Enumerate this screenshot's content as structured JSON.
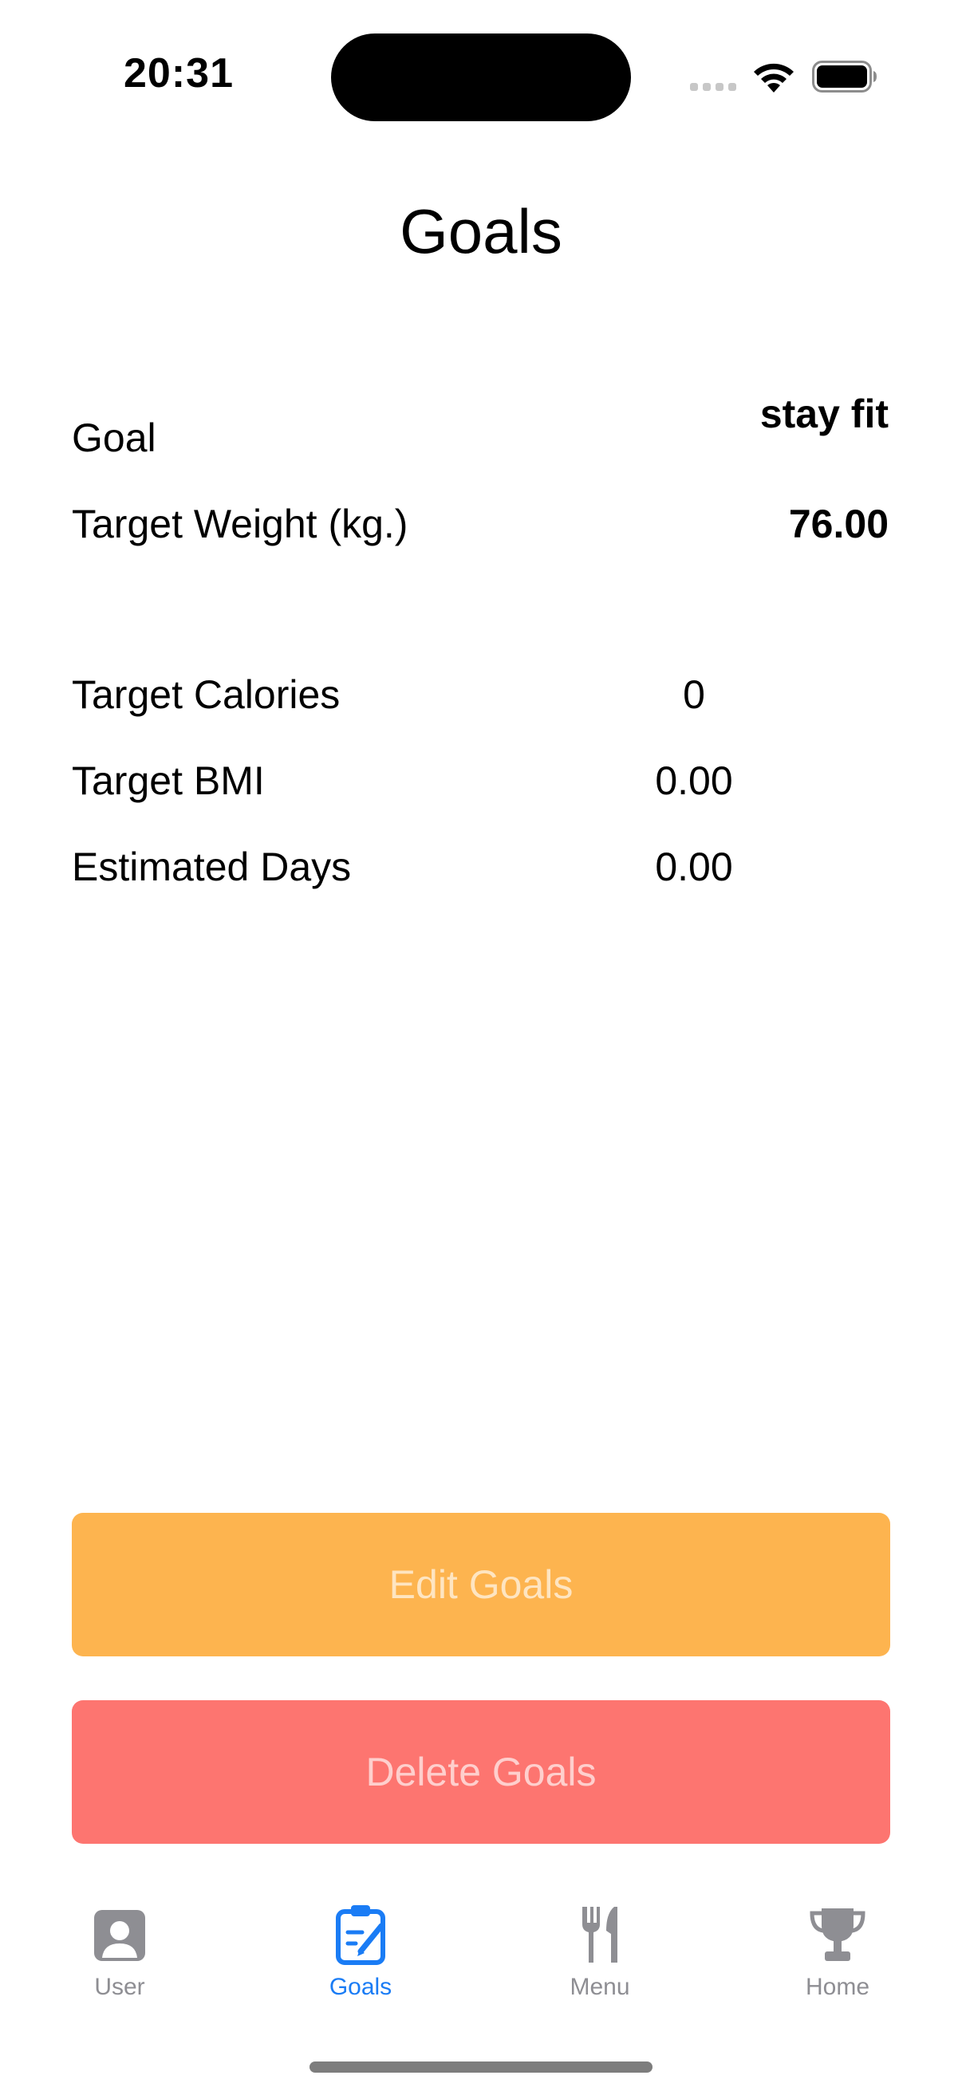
{
  "status_bar": {
    "time": "20:31"
  },
  "header": {
    "title": "Goals"
  },
  "goal_details": {
    "goal_label": "Goal",
    "goal_value": "stay fit",
    "target_weight_label": "Target Weight (kg.)",
    "target_weight_value": "76.00"
  },
  "stats": [
    {
      "label": "Target Calories",
      "value": "0"
    },
    {
      "label": "Target BMI",
      "value": "0.00"
    },
    {
      "label": "Estimated Days",
      "value": "0.00"
    }
  ],
  "actions": {
    "edit_label": "Edit Goals",
    "delete_label": "Delete Goals"
  },
  "tab_bar": {
    "tabs": [
      {
        "label": "User",
        "icon": "person-icon"
      },
      {
        "label": "Goals",
        "icon": "clipboard-edit-icon",
        "active": true
      },
      {
        "label": "Menu",
        "icon": "fork-knife-icon"
      },
      {
        "label": "Home",
        "icon": "trophy-icon"
      }
    ]
  },
  "colors": {
    "edit_button": "#fdb44f",
    "delete_button": "#fd7570",
    "active_tab": "#1a7cf5",
    "inactive_tab": "#8e8e93"
  }
}
